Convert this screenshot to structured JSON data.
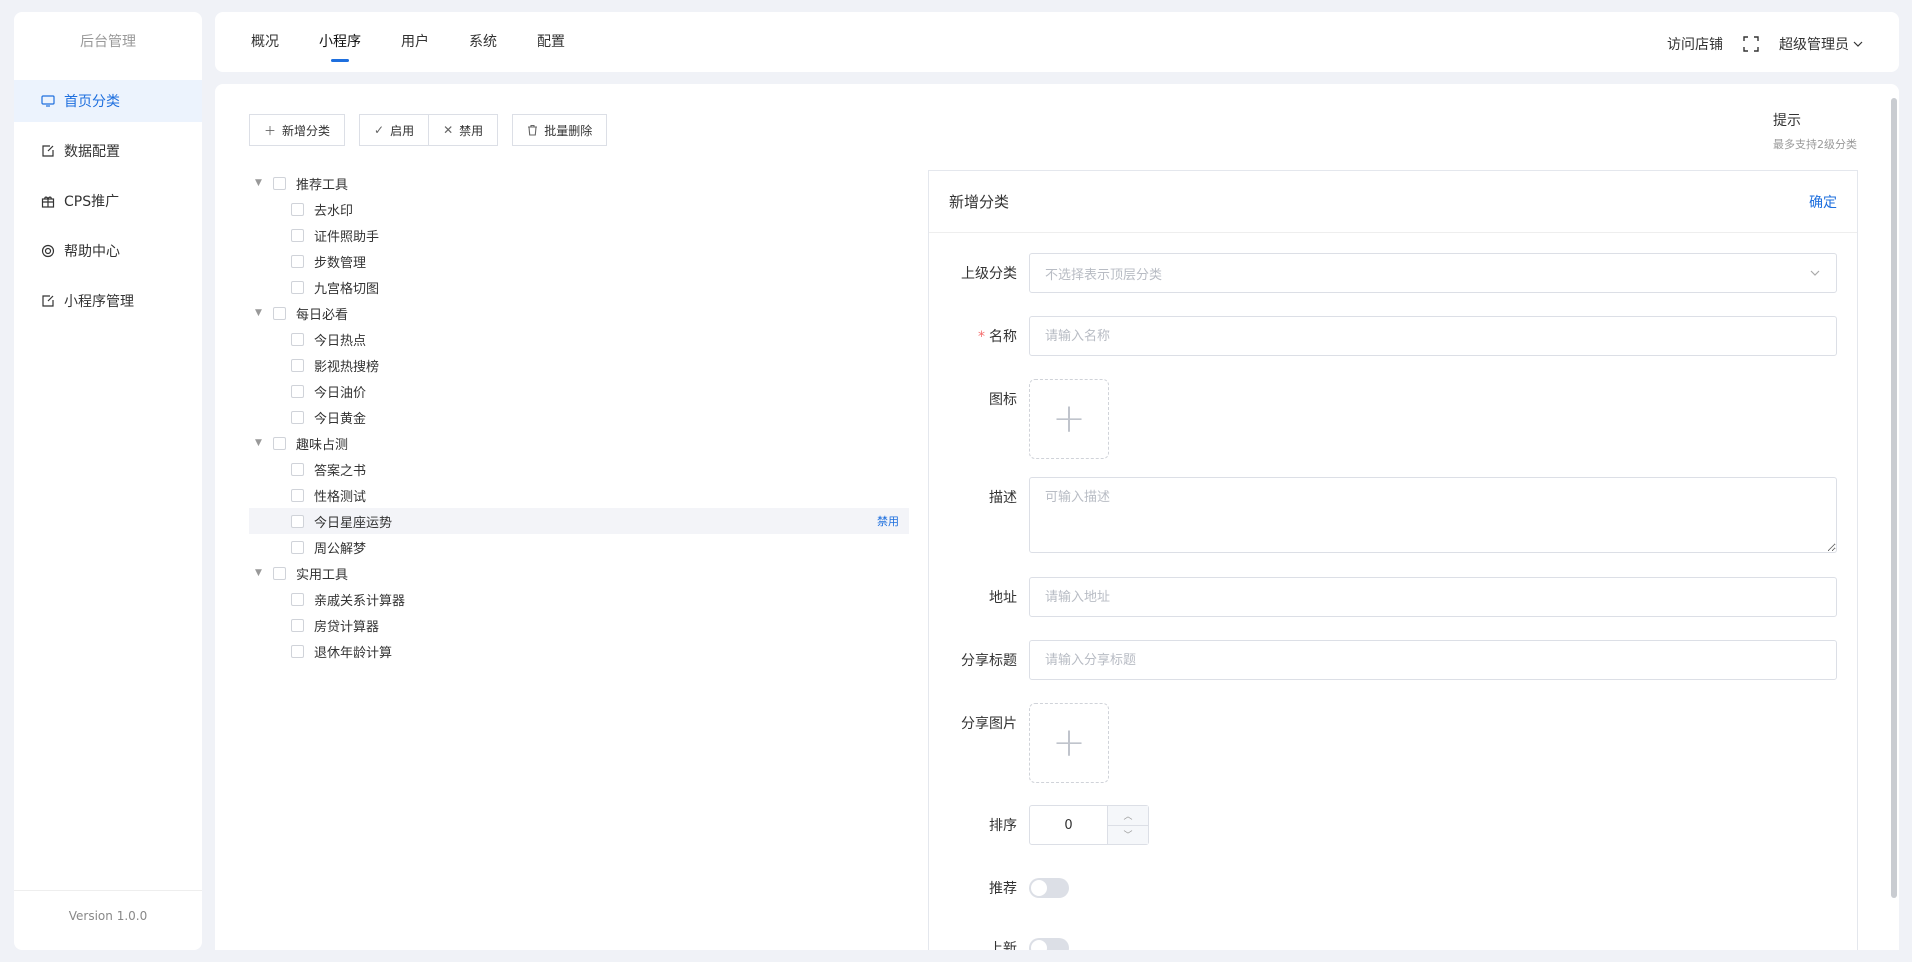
{
  "sidebar": {
    "brand": "后台管理",
    "items": [
      {
        "label": "首页分类",
        "icon": "monitor-icon",
        "active": true
      },
      {
        "label": "数据配置",
        "icon": "note-edit-icon"
      },
      {
        "label": "CPS推广",
        "icon": "gift-icon"
      },
      {
        "label": "帮助中心",
        "icon": "lifebuoy-icon"
      },
      {
        "label": "小程序管理",
        "icon": "note-edit-icon"
      }
    ],
    "version": "Version 1.0.0"
  },
  "topbar": {
    "tabs": [
      "概况",
      "小程序",
      "用户",
      "系统",
      "配置"
    ],
    "active_tab": "小程序",
    "visit_store": "访问店铺",
    "admin": "超级管理员"
  },
  "toolbar": {
    "add": "新增分类",
    "enable": "启用",
    "disable": "禁用",
    "batch_delete": "批量删除"
  },
  "hint": {
    "title": "提示",
    "text": "最多支持2级分类"
  },
  "tree": [
    {
      "label": "推荐工具",
      "children": [
        "去水印",
        "证件照助手",
        "步数管理",
        "九宫格切图"
      ]
    },
    {
      "label": "每日必看",
      "children": [
        "今日热点",
        "影视热搜榜",
        "今日油价",
        "今日黄金"
      ]
    },
    {
      "label": "趣味占测",
      "children": [
        "答案之书",
        "性格测试",
        "今日星座运势",
        "周公解梦"
      ]
    },
    {
      "label": "实用工具",
      "children": [
        "亲戚关系计算器",
        "房贷计算器",
        "退休年龄计算"
      ]
    }
  ],
  "tree_row_action": "禁用",
  "form": {
    "title": "新增分类",
    "confirm": "确定",
    "parent_label": "上级分类",
    "parent_placeholder": "不选择表示顶层分类",
    "name_label": "名称",
    "name_placeholder": "请输入名称",
    "icon_label": "图标",
    "desc_label": "描述",
    "desc_placeholder": "可输入描述",
    "url_label": "地址",
    "url_placeholder": "请输入地址",
    "share_title_label": "分享标题",
    "share_title_placeholder": "请输入分享标题",
    "share_image_label": "分享图片",
    "sort_label": "排序",
    "sort_value": "0",
    "recommend_label": "推荐",
    "new_label": "上新"
  },
  "colors": {
    "accent": "#1e6fde",
    "required": "#f56c6c"
  }
}
